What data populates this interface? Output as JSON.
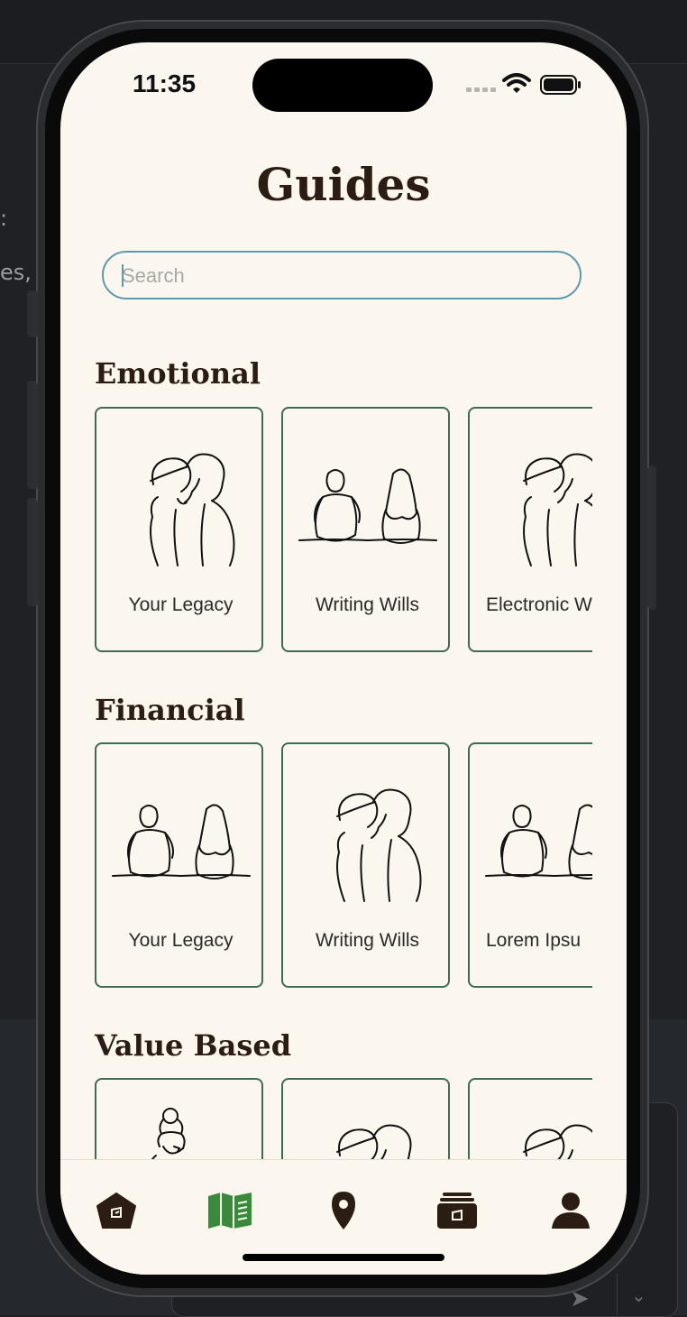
{
  "status_bar": {
    "time": "11:35"
  },
  "header": {
    "title": "Guides"
  },
  "search": {
    "placeholder": "Search",
    "value": ""
  },
  "sections": [
    {
      "title": "Emotional",
      "cards": [
        {
          "label": "Your Legacy",
          "illustration": "couple-kissing"
        },
        {
          "label": "Writing Wills",
          "illustration": "couple-sitting"
        },
        {
          "label": "Electronic W",
          "illustration": "couple-kissing"
        }
      ]
    },
    {
      "title": "Financial",
      "cards": [
        {
          "label": "Your Legacy",
          "illustration": "couple-sitting"
        },
        {
          "label": "Writing Wills",
          "illustration": "couple-kissing"
        },
        {
          "label": "Lorem Ipsu",
          "illustration": "couple-sitting"
        }
      ]
    },
    {
      "title": "Value Based",
      "cards": [
        {
          "label": "",
          "illustration": "woman-bun"
        },
        {
          "label": "",
          "illustration": "couple-kissing"
        },
        {
          "label": "",
          "illustration": "couple-kissing"
        }
      ]
    }
  ],
  "tabbar": {
    "items": [
      {
        "icon": "home-icon",
        "active": false
      },
      {
        "icon": "map-guide-icon",
        "active": true
      },
      {
        "icon": "location-pin-icon",
        "active": false
      },
      {
        "icon": "archive-icon",
        "active": false
      },
      {
        "icon": "profile-icon",
        "active": false
      }
    ]
  },
  "colors": {
    "background": "#fbf7ee",
    "text_dark": "#2b1d14",
    "card_border": "#3e6b52",
    "search_border": "#5c9ab0",
    "active_tab": "#3a8a3c",
    "inactive_tab": "#2b1d14"
  }
}
